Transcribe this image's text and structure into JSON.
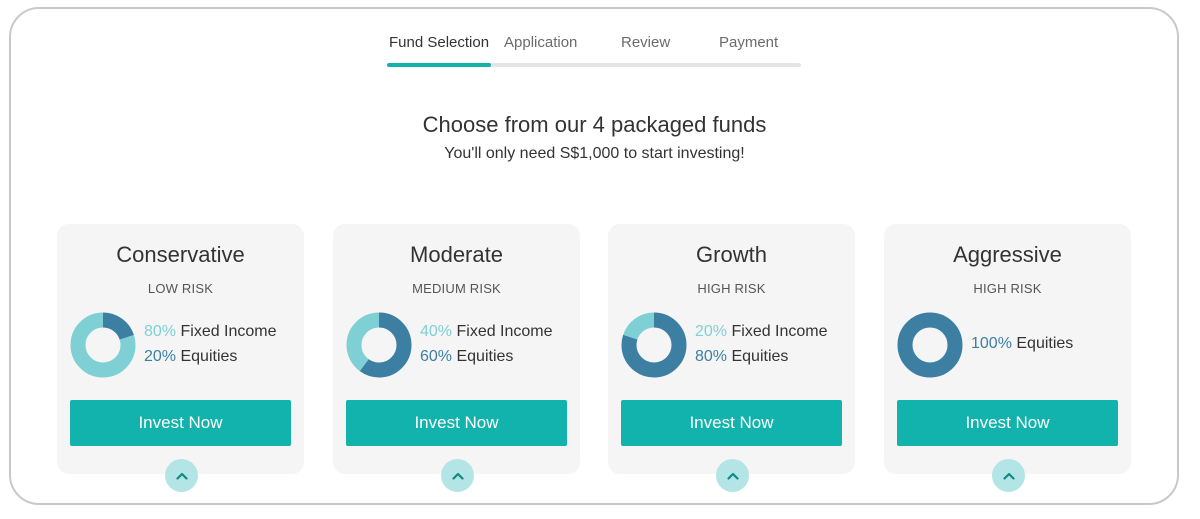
{
  "steps": [
    {
      "label": "Fund Selection"
    },
    {
      "label": "Application"
    },
    {
      "label": "Review"
    },
    {
      "label": "Payment"
    }
  ],
  "stepper_progress_fraction": 0.25,
  "headline": "Choose from our 4 packaged funds",
  "subline": "You'll only need S$1,000 to start investing!",
  "colors": {
    "accent": "#12b3ac",
    "fixed_income": "#7fd0d5",
    "equities": "#3d7fa3"
  },
  "cards": [
    {
      "title": "Conservative",
      "risk": "LOW RISK",
      "fixed_pct": "80%",
      "fixed_label": "Fixed Income",
      "eq_pct": "20%",
      "eq_label": "Equities",
      "fixed_share": 80,
      "eq_share": 20,
      "button": "Invest Now",
      "toggle_icon": "chevron-up-icon"
    },
    {
      "title": "Moderate",
      "risk": "MEDIUM RISK",
      "fixed_pct": "40%",
      "fixed_label": "Fixed Income",
      "eq_pct": "60%",
      "eq_label": "Equities",
      "fixed_share": 40,
      "eq_share": 60,
      "button": "Invest Now",
      "toggle_icon": "chevron-up-icon"
    },
    {
      "title": "Growth",
      "risk": "HIGH RISK",
      "fixed_pct": "20%",
      "fixed_label": "Fixed Income",
      "eq_pct": "80%",
      "eq_label": "Equities",
      "fixed_share": 20,
      "eq_share": 80,
      "button": "Invest Now",
      "toggle_icon": "chevron-up-icon"
    },
    {
      "title": "Aggressive",
      "risk": "HIGH RISK",
      "eq_pct": "100%",
      "eq_label": "Equities",
      "fixed_share": 0,
      "eq_share": 100,
      "button": "Invest Now",
      "toggle_icon": "chevron-up-icon"
    }
  ]
}
